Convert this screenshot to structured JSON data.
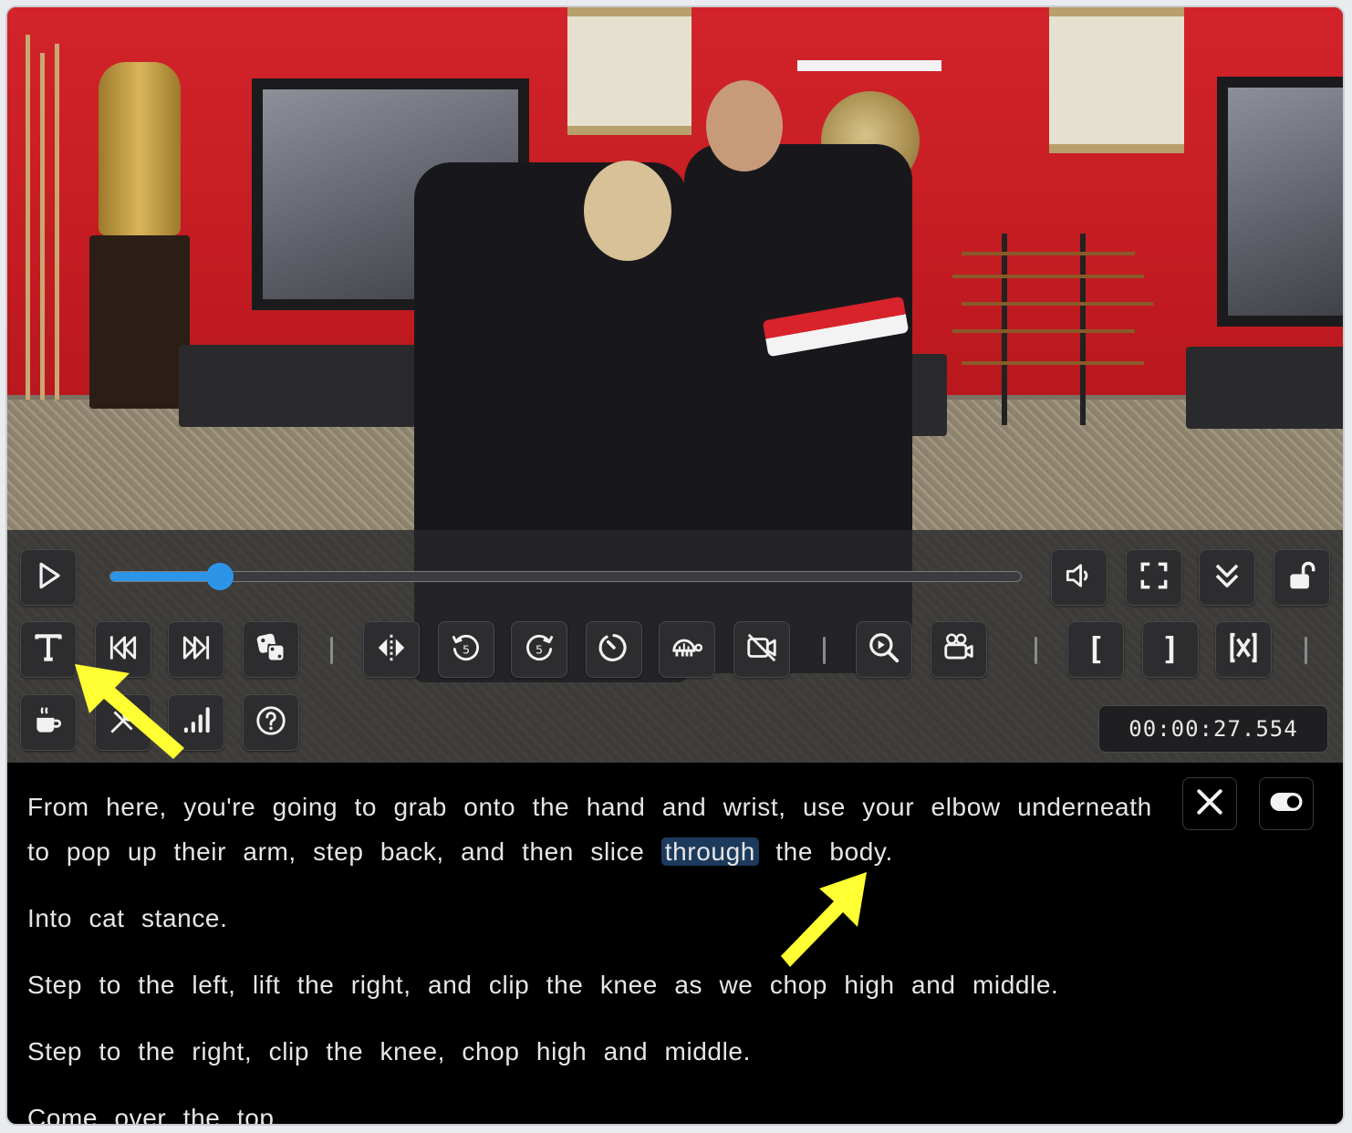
{
  "player": {
    "progress_fraction": 0.12,
    "timecode": "00:00:27.554",
    "colors": {
      "accent": "#2c95e8",
      "button_bg": "#2d2d30",
      "highlight": "#1c3a5c",
      "annotation_arrow": "#ffff33"
    }
  },
  "toolbar_row1": {
    "icons": [
      "play-icon",
      "volume-icon",
      "fullscreen-icon",
      "collapse-icon",
      "unlock-icon"
    ]
  },
  "toolbar_row2": {
    "icons": [
      "transcript-text-icon",
      "skip-back-icon",
      "skip-forward-icon",
      "dice-icon",
      "mirror-icon",
      "rewind-5-icon",
      "forward-5-icon",
      "speed-icon",
      "turtle-icon",
      "hide-video-icon",
      "zoom-icon",
      "camera-icon"
    ],
    "loop_labels": {
      "start": "[",
      "end": "]"
    },
    "clear_loop_icon": "clear-loop-icon"
  },
  "toolbar_row3": {
    "icons": [
      "coffee-icon",
      "tools-icon",
      "signal-icon",
      "help-icon"
    ]
  },
  "transcript": {
    "p1_before": "From here, you're going to grab onto the hand and wrist, use your elbow underneath to pop up their arm, step back, and then slice ",
    "p1_highlight": "through",
    "p1_after": " the body.",
    "p2": "Into cat stance.",
    "p3": "Step to the left, lift the right, and clip the knee as we chop high and middle.",
    "p4": "Step to the right, clip the knee, chop high and middle.",
    "p5": "Come over the top.",
    "controls": {
      "close_icon": "close-icon",
      "toggle_icon": "toggle-icon"
    }
  }
}
